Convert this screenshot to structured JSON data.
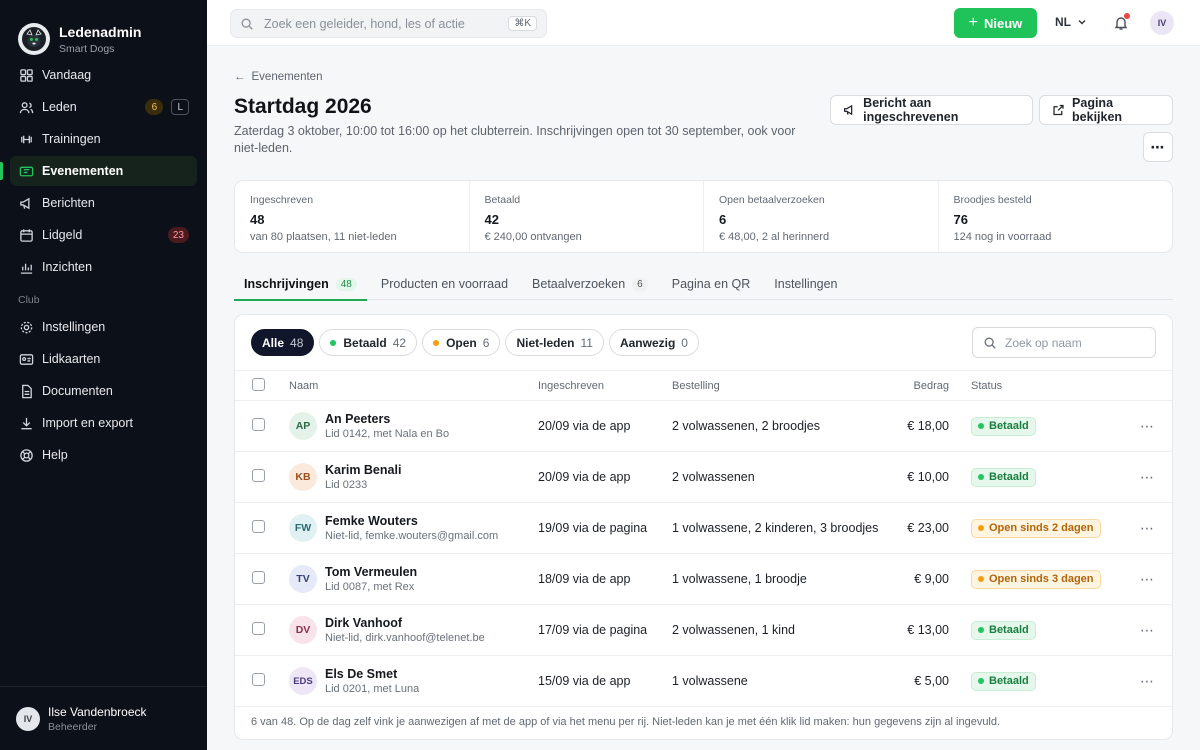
{
  "brand": {
    "name": "Ledenadmin",
    "sub": "Smart Dogs"
  },
  "nav": {
    "items": [
      {
        "label": "Vandaag",
        "icon": "grid-icon"
      },
      {
        "label": "Leden",
        "icon": "users-icon",
        "badge": "6",
        "key": "L"
      },
      {
        "label": "Trainingen",
        "icon": "dumbbell-icon"
      },
      {
        "label": "Evenementen",
        "icon": "ticket-icon",
        "active": true
      },
      {
        "label": "Berichten",
        "icon": "megaphone-icon"
      },
      {
        "label": "Lidgeld",
        "icon": "calendar-icon",
        "badge": "23"
      },
      {
        "label": "Inzichten",
        "icon": "chart-icon"
      }
    ],
    "section": "Club",
    "club_items": [
      {
        "label": "Instellingen",
        "icon": "gear-icon"
      },
      {
        "label": "Lidkaarten",
        "icon": "card-icon"
      },
      {
        "label": "Documenten",
        "icon": "document-icon"
      },
      {
        "label": "Import en export",
        "icon": "download-icon"
      },
      {
        "label": "Help",
        "icon": "help-icon"
      }
    ]
  },
  "user": {
    "initials": "IV",
    "name": "Ilse Vandenbroeck",
    "role": "Beheerder"
  },
  "topbar": {
    "search_placeholder": "Zoek een geleider, hond, les of actie",
    "shortcut": "⌘K",
    "new_label": "Nieuw",
    "lang": "NL",
    "avatar": "IV"
  },
  "page": {
    "breadcrumb": "Evenementen",
    "title": "Startdag 2026",
    "subtitle": "Zaterdag 3 oktober, 10:00 tot 16:00 op het clubterrein. Inschrijvingen open tot 30 september, ook voor niet-leden.",
    "btn_message": "Bericht aan ingeschrevenen",
    "btn_page": "Pagina bekijken"
  },
  "stats": [
    {
      "label": "Ingeschreven",
      "value": "48",
      "note": "van 80 plaatsen, 11 niet-leden"
    },
    {
      "label": "Betaald",
      "value": "42",
      "note": "€ 240,00 ontvangen"
    },
    {
      "label": "Open betaalverzoeken",
      "value": "6",
      "note": "€ 48,00, 2 al herinnerd"
    },
    {
      "label": "Broodjes besteld",
      "value": "76",
      "note": "124 nog in voorraad"
    }
  ],
  "tabs": [
    {
      "label": "Inschrijvingen",
      "count": "48",
      "active": true
    },
    {
      "label": "Producten en voorraad",
      "count": ""
    },
    {
      "label": "Betaalverzoeken",
      "count": "6"
    },
    {
      "label": "Pagina en QR",
      "count": ""
    },
    {
      "label": "Instellingen",
      "count": ""
    }
  ],
  "filters": [
    {
      "label": "Alle",
      "count": "48",
      "active": true,
      "dot": ""
    },
    {
      "label": "Betaald",
      "count": "42",
      "dot": "#22c55e"
    },
    {
      "label": "Open",
      "count": "6",
      "dot": "#f59e0b"
    },
    {
      "label": "Niet-leden",
      "count": "11",
      "dot": ""
    },
    {
      "label": "Aanwezig",
      "count": "0",
      "dot": ""
    }
  ],
  "name_search_placeholder": "Zoek op naam",
  "table": {
    "headers": {
      "name": "Naam",
      "registered": "Ingeschreven",
      "order": "Bestelling",
      "amount": "Bedrag",
      "status": "Status"
    },
    "rows": [
      {
        "initials": "AP",
        "avatar_bg": "#e4f3ea",
        "avatar_fg": "#2d6a45",
        "name": "An Peeters",
        "sub": "Lid 0142, met Nala en Bo",
        "registered": "20/09 via de app",
        "order": "2 volwassenen, 2 broodjes",
        "amount": "€ 18,00",
        "status": "Betaald",
        "status_type": "paid"
      },
      {
        "initials": "KB",
        "avatar_bg": "#fbe9dc",
        "avatar_fg": "#9a4f1c",
        "name": "Karim Benali",
        "sub": "Lid 0233",
        "registered": "20/09 via de app",
        "order": "2 volwassenen",
        "amount": "€ 10,00",
        "status": "Betaald",
        "status_type": "paid"
      },
      {
        "initials": "FW",
        "avatar_bg": "#e0f1f3",
        "avatar_fg": "#2a6a73",
        "name": "Femke Wouters",
        "sub": "Niet-lid, femke.wouters@gmail.com",
        "registered": "19/09 via de pagina",
        "order": "1 volwassene, 2 kinderen, 3 broodjes",
        "amount": "€ 23,00",
        "status": "Open sinds 2 dagen",
        "status_type": "open"
      },
      {
        "initials": "TV",
        "avatar_bg": "#e5e9f8",
        "avatar_fg": "#34427a",
        "name": "Tom Vermeulen",
        "sub": "Lid 0087, met Rex",
        "registered": "18/09 via de app",
        "order": "1 volwassene, 1 broodje",
        "amount": "€ 9,00",
        "status": "Open sinds 3 dagen",
        "status_type": "open"
      },
      {
        "initials": "DV",
        "avatar_bg": "#f8e3ea",
        "avatar_fg": "#8a2f4e",
        "name": "Dirk Vanhoof",
        "sub": "Niet-lid, dirk.vanhoof@telenet.be",
        "registered": "17/09 via de pagina",
        "order": "2 volwassenen, 1 kind",
        "amount": "€ 13,00",
        "status": "Betaald",
        "status_type": "paid"
      },
      {
        "initials": "EDS",
        "avatar_bg": "#ece6f7",
        "avatar_fg": "#4b3a80",
        "name": "Els De Smet",
        "sub": "Lid 0201, met Luna",
        "registered": "15/09 via de app",
        "order": "1 volwassene",
        "amount": "€ 5,00",
        "status": "Betaald",
        "status_type": "paid"
      }
    ]
  },
  "footnote": "6 van 48. Op de dag zelf vink je aanwezigen af met de app of via het menu per rij. Niet-leden kan je met één klik lid maken: hun gegevens zijn al ingevuld."
}
